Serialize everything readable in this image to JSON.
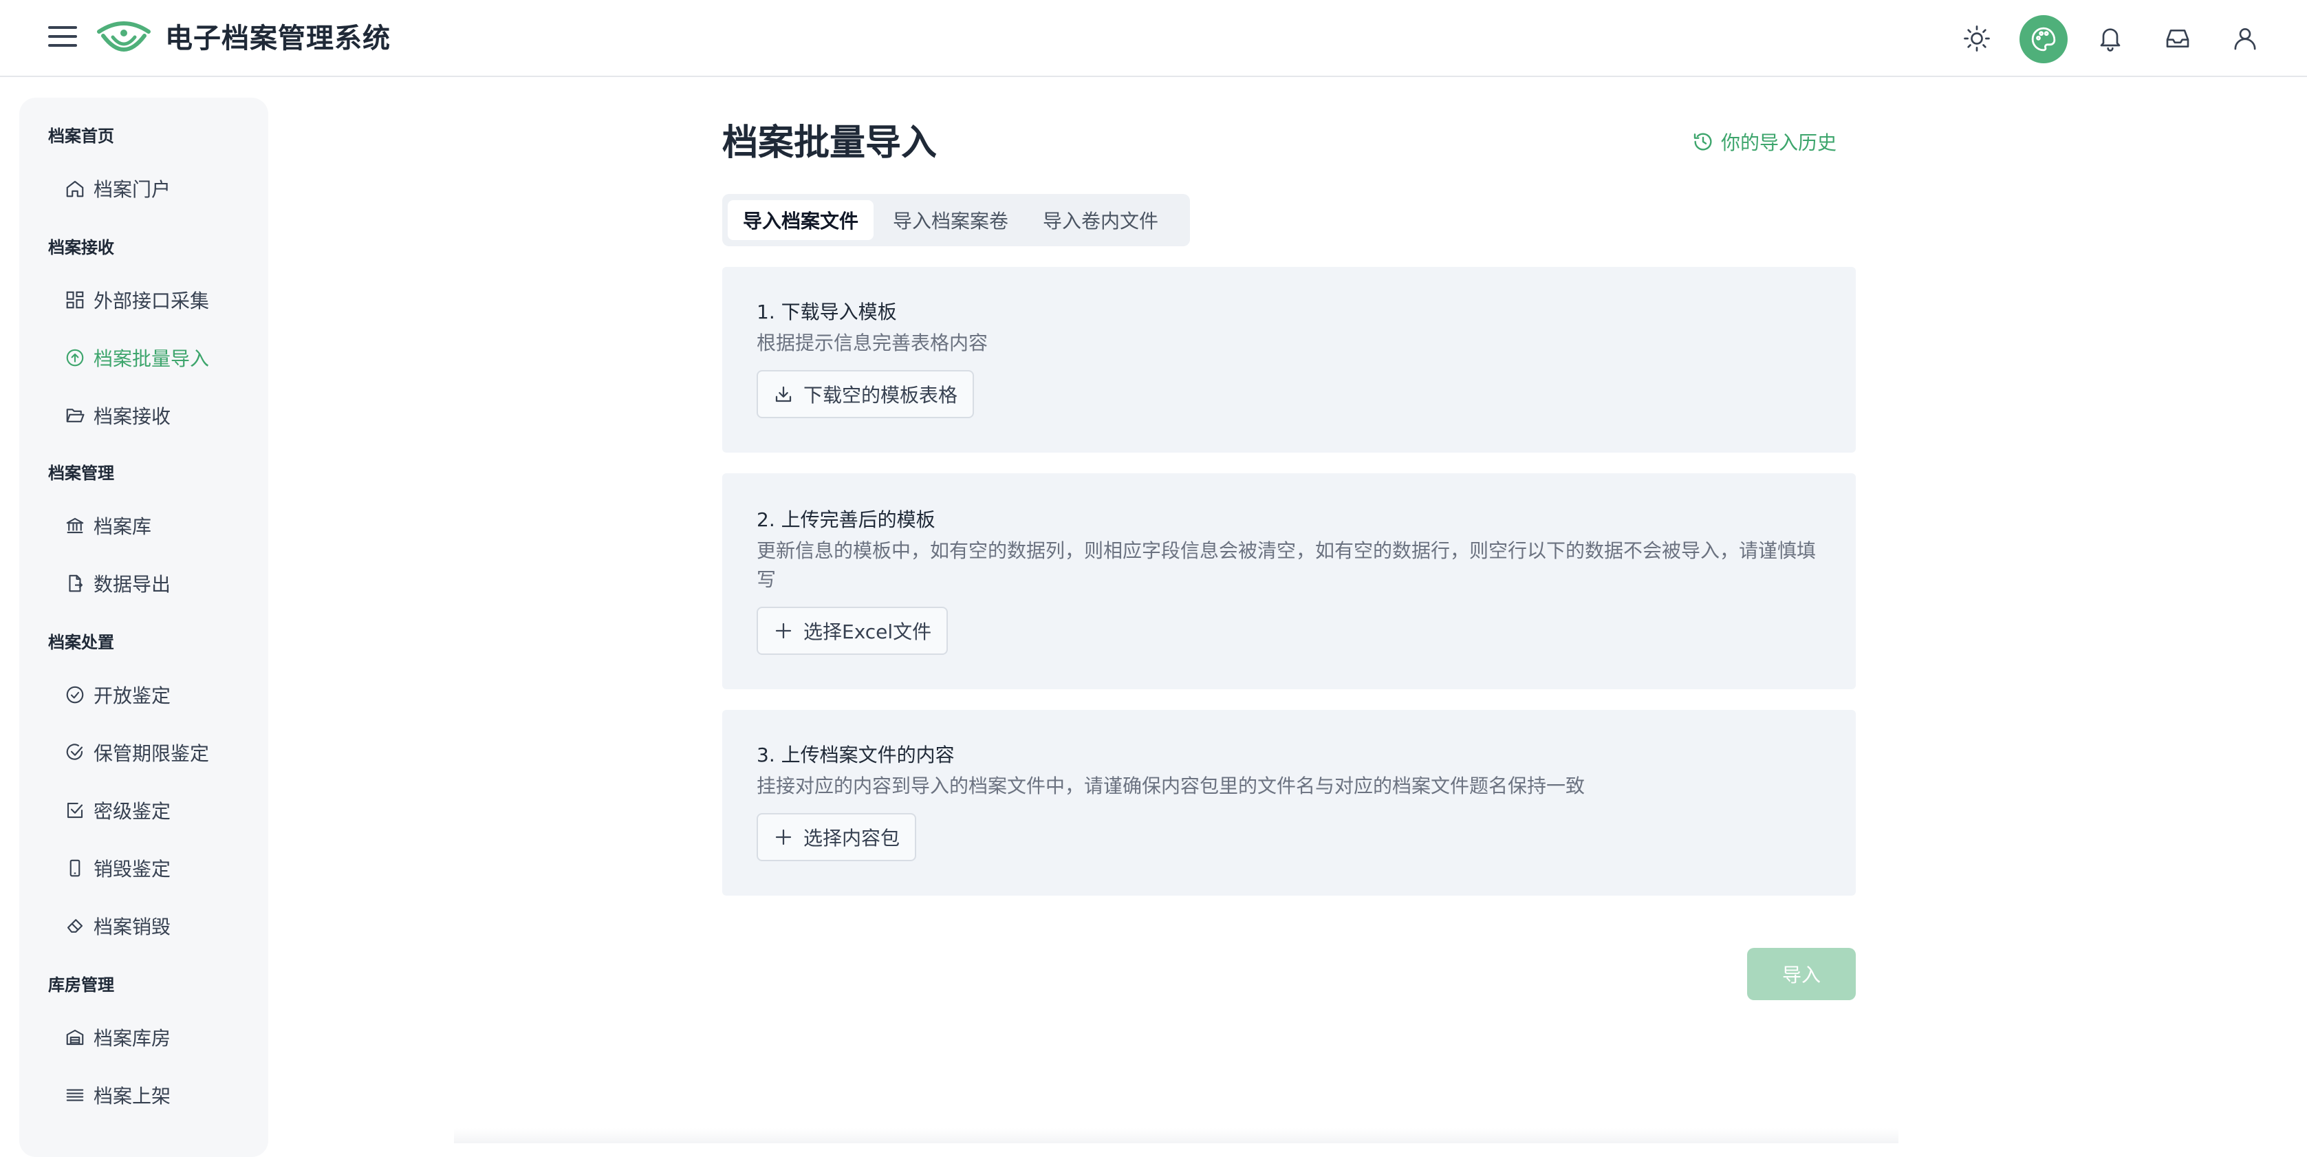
{
  "header": {
    "app_title": "电子档案管理系统",
    "accent_color": "#4fb07a",
    "icons": [
      "menu-icon",
      "sun-icon",
      "palette-icon",
      "bell-icon",
      "inbox-icon",
      "user-icon"
    ]
  },
  "sidebar": {
    "groups": [
      {
        "label": "档案首页",
        "items": [
          {
            "label": "档案门户",
            "icon": "home-icon"
          }
        ]
      },
      {
        "label": "档案接收",
        "items": [
          {
            "label": "外部接口采集",
            "icon": "grid-icon"
          },
          {
            "label": "档案批量导入",
            "icon": "upload-circle-icon",
            "active": true
          },
          {
            "label": "档案接收",
            "icon": "folder-open-icon"
          }
        ]
      },
      {
        "label": "档案管理",
        "items": [
          {
            "label": "档案库",
            "icon": "bank-icon"
          },
          {
            "label": "数据导出",
            "icon": "file-export-icon"
          }
        ]
      },
      {
        "label": "档案处置",
        "items": [
          {
            "label": "开放鉴定",
            "icon": "check-circle-icon"
          },
          {
            "label": "保管期限鉴定",
            "icon": "check-circle-icon"
          },
          {
            "label": "密级鉴定",
            "icon": "check-square-icon"
          },
          {
            "label": "销毁鉴定",
            "icon": "phone-icon"
          },
          {
            "label": "档案销毁",
            "icon": "eraser-icon"
          }
        ]
      },
      {
        "label": "库房管理",
        "items": [
          {
            "label": "档案库房",
            "icon": "warehouse-icon"
          },
          {
            "label": "档案上架",
            "icon": "list-icon"
          }
        ]
      }
    ]
  },
  "main": {
    "title": "档案批量导入",
    "history_link": "你的导入历史",
    "tabs": [
      {
        "label": "导入档案文件",
        "active": true
      },
      {
        "label": "导入档案案卷"
      },
      {
        "label": "导入卷内文件"
      }
    ],
    "steps": [
      {
        "title": "1. 下载导入模板",
        "desc": "根据提示信息完善表格内容",
        "button": "下载空的模板表格",
        "button_icon": "download-icon"
      },
      {
        "title": "2. 上传完善后的模板",
        "desc": "更新信息的模板中，如有空的数据列，则相应字段信息会被清空，如有空的数据行，则空行以下的数据不会被导入，请谨慎填写",
        "button": "选择Excel文件",
        "button_icon": "plus-icon"
      },
      {
        "title": "3. 上传档案文件的内容",
        "desc": "挂接对应的内容到导入的档案文件中，请谨确保内容包里的文件名与对应的档案文件题名保持一致",
        "button": "选择内容包",
        "button_icon": "plus-icon"
      }
    ],
    "import_button": "导入"
  }
}
